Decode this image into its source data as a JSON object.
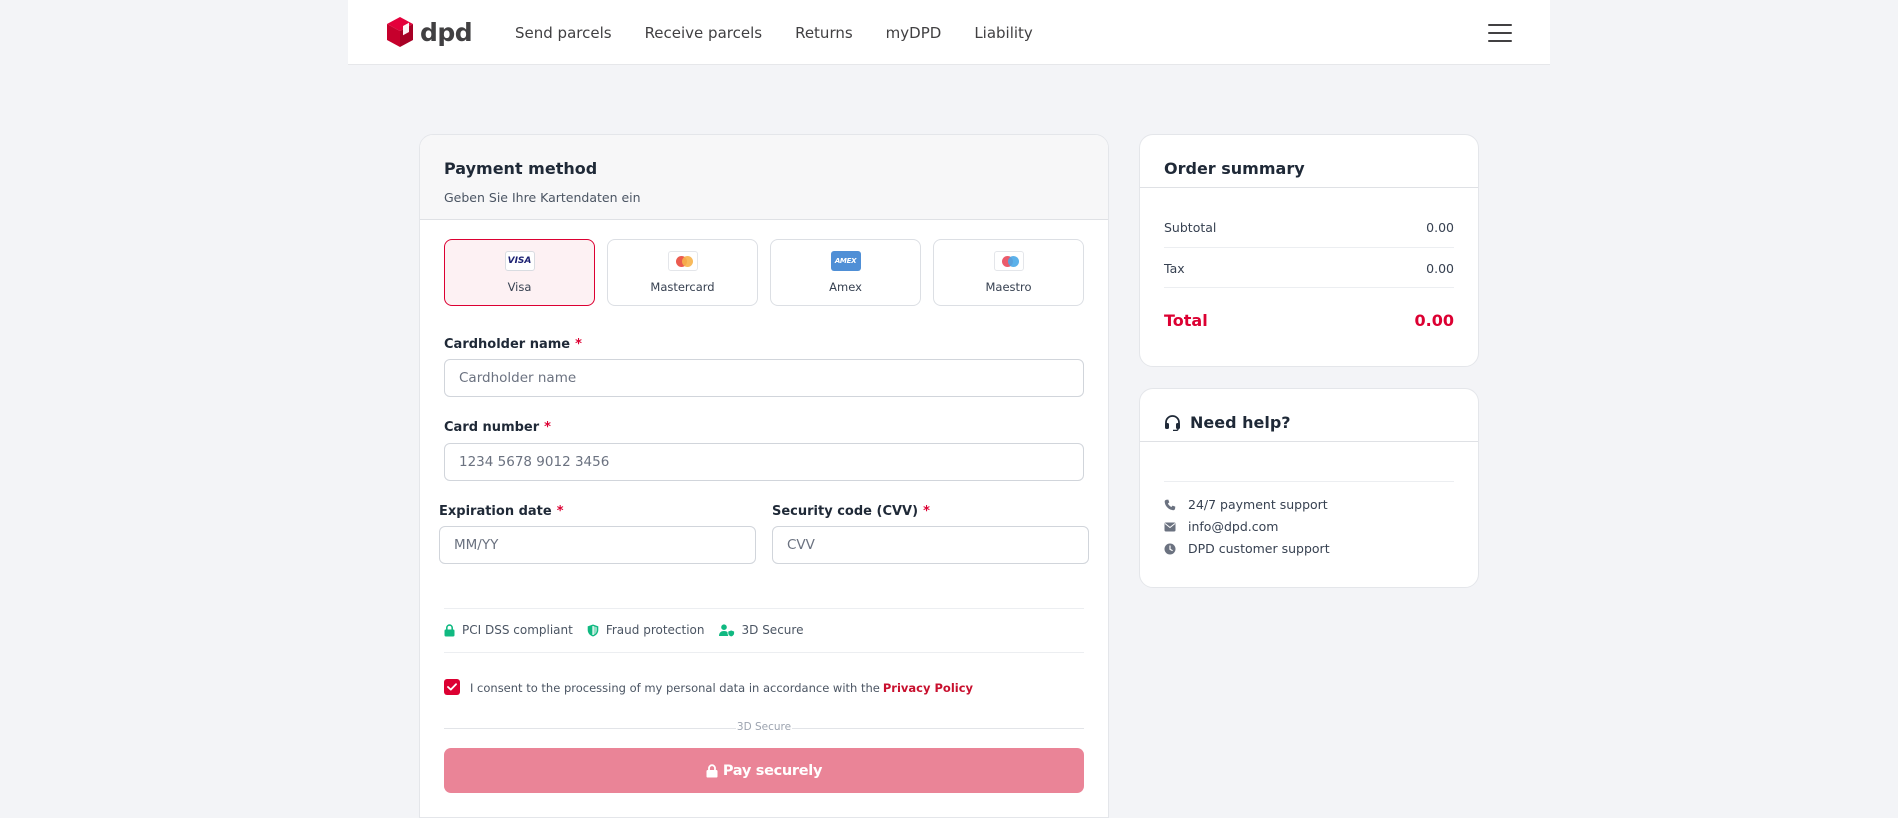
{
  "header": {
    "logo_text": "dpd",
    "nav": [
      "Send parcels",
      "Receive parcels",
      "Returns",
      "myDPD",
      "Liability"
    ]
  },
  "payment": {
    "title": "Payment method",
    "subtitle": "Geben Sie Ihre Kartendaten ein",
    "methods": [
      {
        "label": "Visa",
        "brand": "VISA",
        "selected": true
      },
      {
        "label": "Mastercard",
        "brand": "mastercard-icon"
      },
      {
        "label": "Amex",
        "brand": "AMEX"
      },
      {
        "label": "Maestro",
        "brand": "maestro-icon"
      }
    ],
    "cardholder_label": "Cardholder name",
    "cardholder_placeholder": "Cardholder name",
    "card_number_label": "Card number",
    "card_number_placeholder": "1234 5678 9012 3456",
    "expiry_label": "Expiration date",
    "expiry_placeholder": "MM/YY",
    "cvv_label": "Security code (CVV)",
    "cvv_placeholder": "CVV",
    "required_mark": "*",
    "badges": [
      "PCI DSS compliant",
      "Fraud protection",
      "3D Secure"
    ],
    "consent_text": "I consent to the processing of my personal data in accordance with the",
    "consent_link": "Privacy Policy",
    "consent_checked": true,
    "separator_text": "3D Secure",
    "pay_button": "Pay securely"
  },
  "summary": {
    "title": "Order summary",
    "subtotal_label": "Subtotal",
    "subtotal_value": "0.00",
    "tax_label": "Tax",
    "tax_value": "0.00",
    "total_label": "Total",
    "total_value": "0.00"
  },
  "help": {
    "title": "Need help?",
    "items": [
      "24/7 payment support",
      "info@dpd.com",
      "DPD customer support"
    ]
  },
  "colors": {
    "brand_red": "#dc0032",
    "pay_button": "#ea8497",
    "badge_green": "#10b981",
    "help_icon": "#6b7280"
  }
}
